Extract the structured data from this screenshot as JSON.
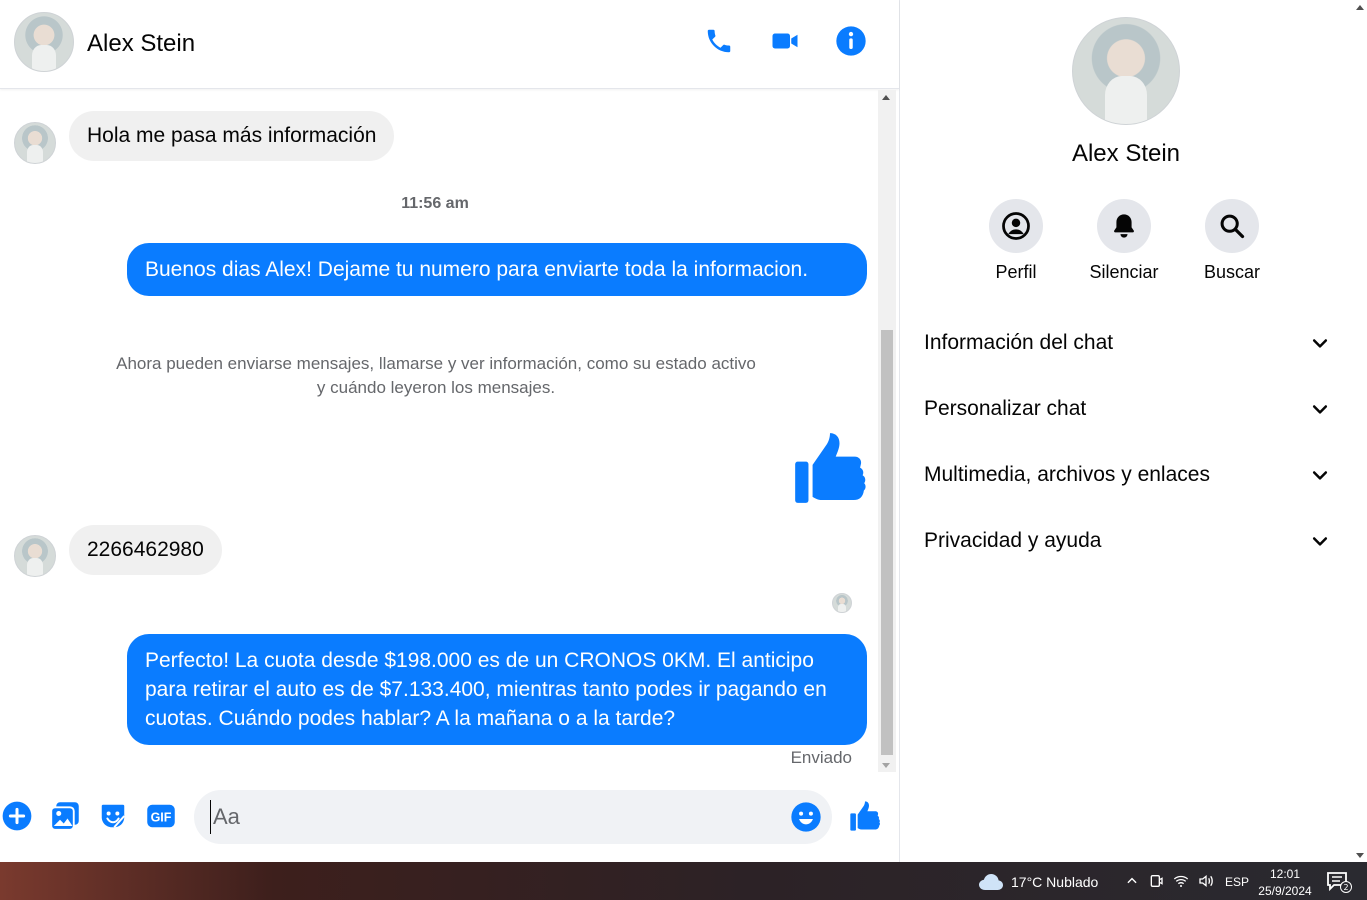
{
  "contact": {
    "name": "Alex Stein"
  },
  "colors": {
    "accent": "#0a7cff",
    "incoming_bubble": "#f0f0f0",
    "muted_text": "#65676b"
  },
  "header": {
    "icons": [
      "phone-icon",
      "video-camera-icon",
      "info-icon"
    ]
  },
  "messages": {
    "incoming_1": "Hola me pasa más información",
    "timestamp": "11:56 am",
    "outgoing_1": "Buenos dias Alex! Dejame tu numero para enviarte toda la informacion.",
    "system_note": "Ahora pueden enviarse mensajes, llamarse y ver información, como su estado activo y cuándo leyeron los mensajes.",
    "incoming_2": "2266462980",
    "outgoing_2": "Perfecto! La cuota desde $198.000 es de un CRONOS 0KM. El anticipo para retirar el auto es de $7.133.400, mientras tanto podes ir pagando en cuotas. Cuándo podes hablar? A la mañana o a la tarde?",
    "status": "Enviado"
  },
  "composer": {
    "placeholder": "Aa",
    "icons": [
      "plus-icon",
      "image-icon",
      "sticker-icon",
      "gif-icon",
      "emoji-icon",
      "like-icon"
    ]
  },
  "info_panel": {
    "name": "Alex Stein",
    "actions": [
      {
        "label": "Perfil",
        "icon": "profile-icon"
      },
      {
        "label": "Silenciar",
        "icon": "bell-icon"
      },
      {
        "label": "Buscar",
        "icon": "search-icon"
      }
    ],
    "sections": [
      "Información del chat",
      "Personalizar chat",
      "Multimedia, archivos y enlaces",
      "Privacidad y ayuda"
    ]
  },
  "taskbar": {
    "weather": "17°C  Nublado",
    "language": "ESP",
    "time": "12:01",
    "date": "25/9/2024",
    "notification_count": "2"
  }
}
